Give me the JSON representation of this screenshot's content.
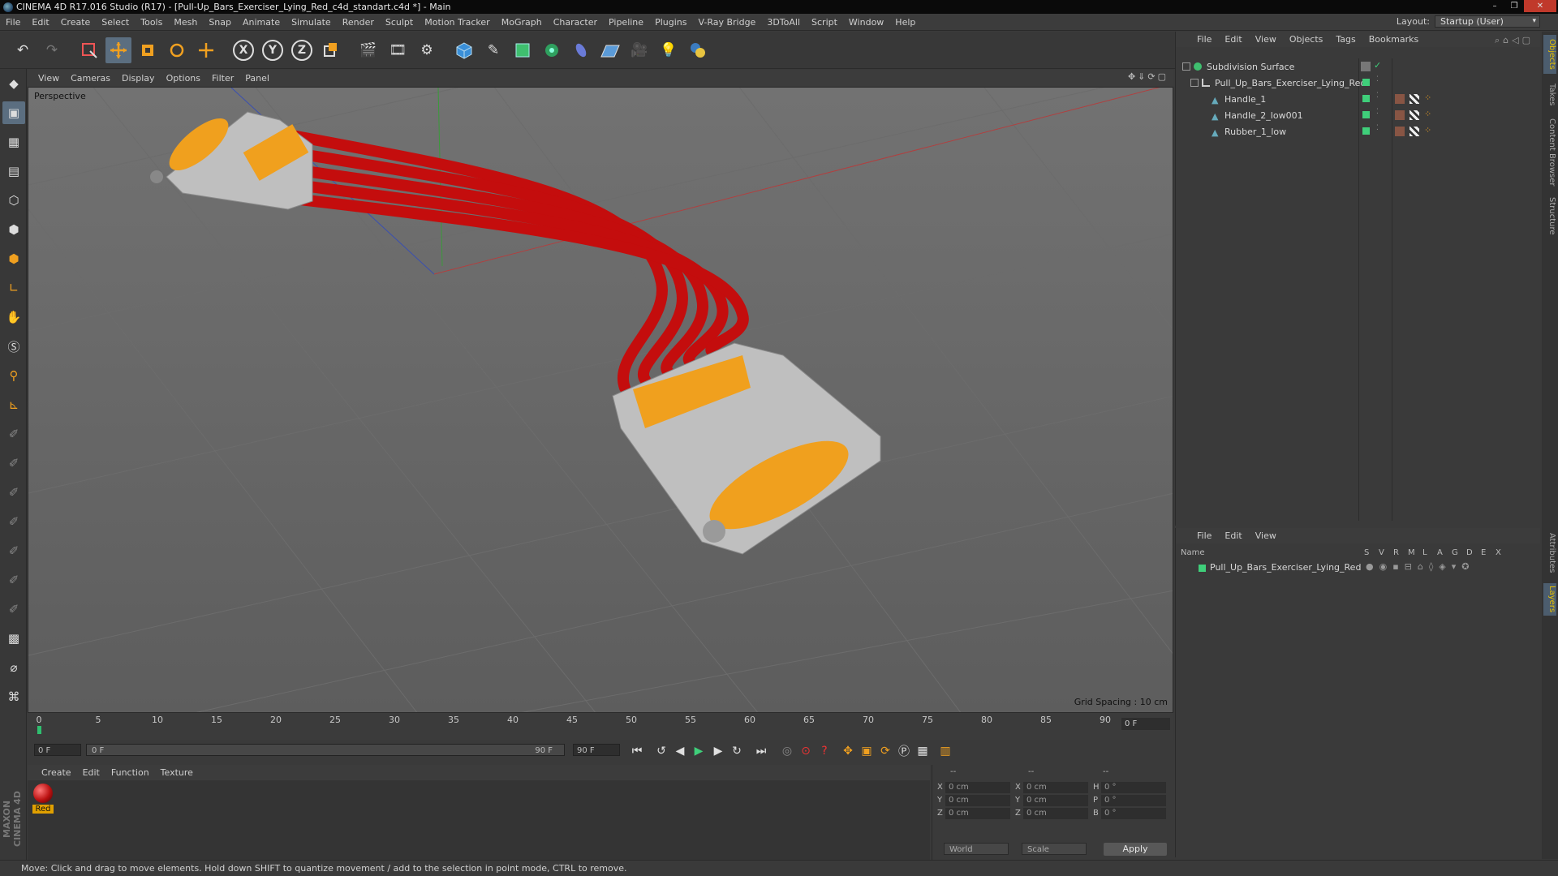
{
  "window": {
    "title": "CINEMA 4D R17.016 Studio (R17) - [Pull-Up_Bars_Exerciser_Lying_Red_c4d_standart.c4d *] - Main",
    "controls": [
      "–",
      "❐",
      "✕"
    ]
  },
  "menubar": {
    "items": [
      "File",
      "Edit",
      "Create",
      "Select",
      "Tools",
      "Mesh",
      "Snap",
      "Animate",
      "Simulate",
      "Render",
      "Sculpt",
      "Motion Tracker",
      "MoGraph",
      "Character",
      "Pipeline",
      "Plugins",
      "V-Ray Bridge",
      "3DToAll",
      "Script",
      "Window",
      "Help"
    ],
    "layout_label": "Layout:",
    "layout_value": "Startup (User)"
  },
  "toolbar": {
    "axis_x": "X",
    "axis_y": "Y",
    "axis_z": "Z"
  },
  "viewport": {
    "menu": [
      "View",
      "Cameras",
      "Display",
      "Options",
      "Filter",
      "Panel"
    ],
    "label": "Perspective",
    "grid_spacing": "Grid Spacing : 10 cm",
    "rubber_color": "#c40d0d",
    "handle_color": "#f0a01e",
    "frame_color": "#bfbfbf"
  },
  "timeline": {
    "ticks": [
      "0",
      "5",
      "10",
      "15",
      "20",
      "25",
      "30",
      "35",
      "40",
      "45",
      "50",
      "55",
      "60",
      "65",
      "70",
      "75",
      "80",
      "85",
      "90"
    ],
    "current_frame": "0 F"
  },
  "transport": {
    "start_field": "0 F",
    "range_start": "0 F",
    "range_end": "90 F",
    "end_field": "90 F"
  },
  "material_manager": {
    "menu": [
      "Create",
      "Edit",
      "Function",
      "Texture"
    ],
    "materials": [
      {
        "name": "Red"
      }
    ]
  },
  "coordinates": {
    "header": [
      "--",
      "--",
      "--"
    ],
    "pos_labels": [
      "X",
      "Y",
      "Z"
    ],
    "size_labels": [
      "X",
      "Y",
      "Z"
    ],
    "rot_labels": [
      "H",
      "P",
      "B"
    ],
    "pos_values": [
      "0 cm",
      "0 cm",
      "0 cm"
    ],
    "size_values": [
      "0 cm",
      "0 cm",
      "0 cm"
    ],
    "rot_values": [
      "0 °",
      "0 °",
      "0 °"
    ],
    "mode_world": "World",
    "mode_scale": "Scale",
    "apply": "Apply"
  },
  "object_manager": {
    "menu": [
      "File",
      "Edit",
      "View",
      "Objects",
      "Tags",
      "Bookmarks"
    ],
    "objects": [
      {
        "name": "Subdivision Surface"
      },
      {
        "name": "Pull_Up_Bars_Exerciser_Lying_Red"
      },
      {
        "name": "Handle_1"
      },
      {
        "name": "Handle_2_low001"
      },
      {
        "name": "Rubber_1_low"
      }
    ]
  },
  "layer_manager": {
    "menu": [
      "File",
      "Edit",
      "View"
    ],
    "columns": [
      "Name",
      "S",
      "V",
      "R",
      "M",
      "L",
      "A",
      "G",
      "D",
      "E",
      "X"
    ],
    "layers": [
      {
        "name": "Pull_Up_Bars_Exerciser_Lying_Red",
        "color": "#3fcf7a"
      }
    ]
  },
  "side_tabs": [
    "Objects",
    "Takes",
    "Content Browser",
    "Structure",
    "Attributes",
    "Layers"
  ],
  "status": {
    "text": "Move: Click and drag to move elements. Hold down SHIFT to quantize movement / add to the selection in point mode, CTRL to remove."
  },
  "branding": "MAXON CINEMA 4D"
}
